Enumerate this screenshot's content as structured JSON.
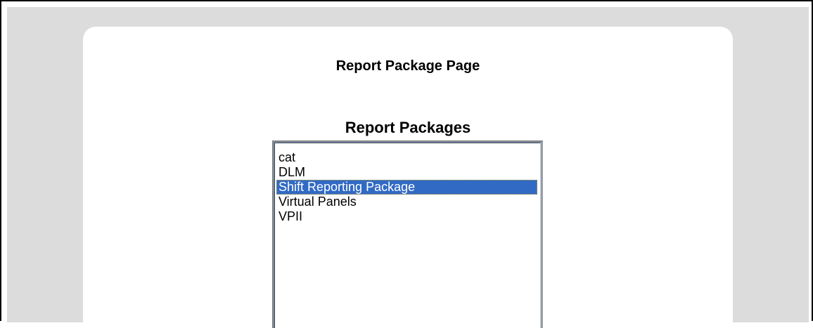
{
  "page": {
    "title": "Report Package Page"
  },
  "report_packages": {
    "heading": "Report Packages",
    "selected_index": 2,
    "items": [
      {
        "label": "cat"
      },
      {
        "label": "DLM"
      },
      {
        "label": "Shift Reporting Package"
      },
      {
        "label": "Virtual Panels"
      },
      {
        "label": "VPII"
      }
    ]
  },
  "colors": {
    "background_gray": "#dcdcdc",
    "panel": "#ffffff",
    "selection": "#316ac5",
    "selection_text": "#ffffff"
  }
}
